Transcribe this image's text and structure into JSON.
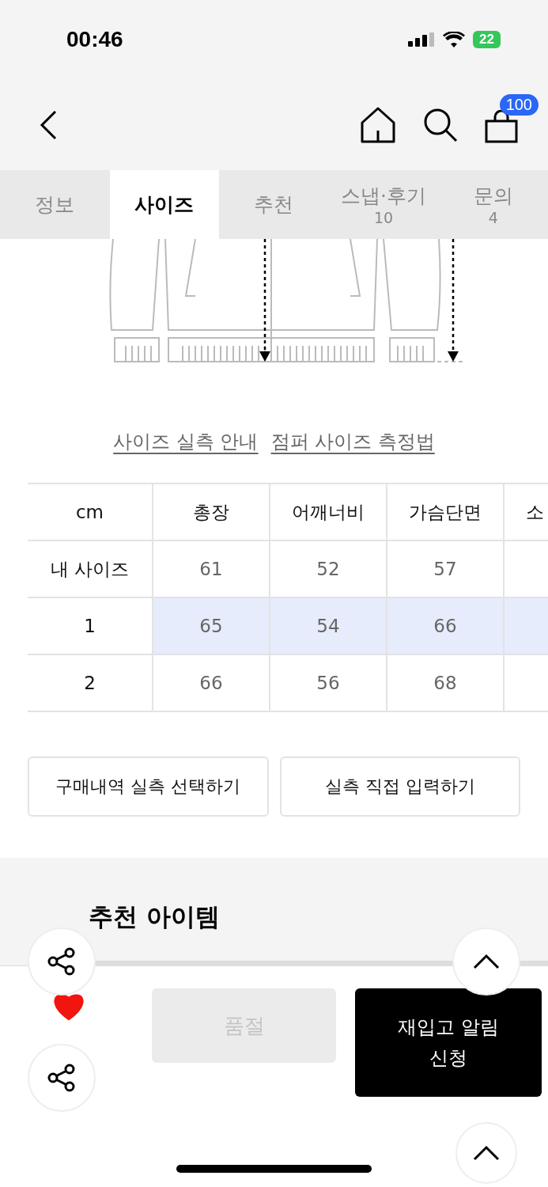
{
  "status_bar": {
    "time": "00:46",
    "battery": "22"
  },
  "nav": {
    "cart_count": "100"
  },
  "tabs": [
    {
      "label": "정보",
      "selected": false
    },
    {
      "label": "사이즈",
      "selected": true
    },
    {
      "label": "추천",
      "selected": false
    },
    {
      "label": "스냅·후기",
      "count": "10",
      "selected": false
    },
    {
      "label": "문의",
      "count": "4",
      "selected": false
    }
  ],
  "size_links": [
    "사이즈 실측 안내",
    "점퍼 사이즈 측정법"
  ],
  "size_table": {
    "columns": [
      "cm",
      "총장",
      "어깨너비",
      "가슴단면",
      "소"
    ],
    "rows": [
      {
        "label": "내 사이즈",
        "values": [
          "61",
          "52",
          "57"
        ],
        "selected": false
      },
      {
        "label": "1",
        "values": [
          "65",
          "54",
          "66"
        ],
        "selected": true
      },
      {
        "label": "2",
        "values": [
          "66",
          "56",
          "68"
        ],
        "selected": false
      }
    ]
  },
  "buttons": [
    "구매내역 실측 선택하기",
    "실측 직접 입력하기"
  ],
  "recommend": {
    "title": "추천 아이템"
  },
  "bottom_bar": {
    "liked": true,
    "sold_out_label": "품절",
    "restock_label": "재입고 알림 신청"
  }
}
